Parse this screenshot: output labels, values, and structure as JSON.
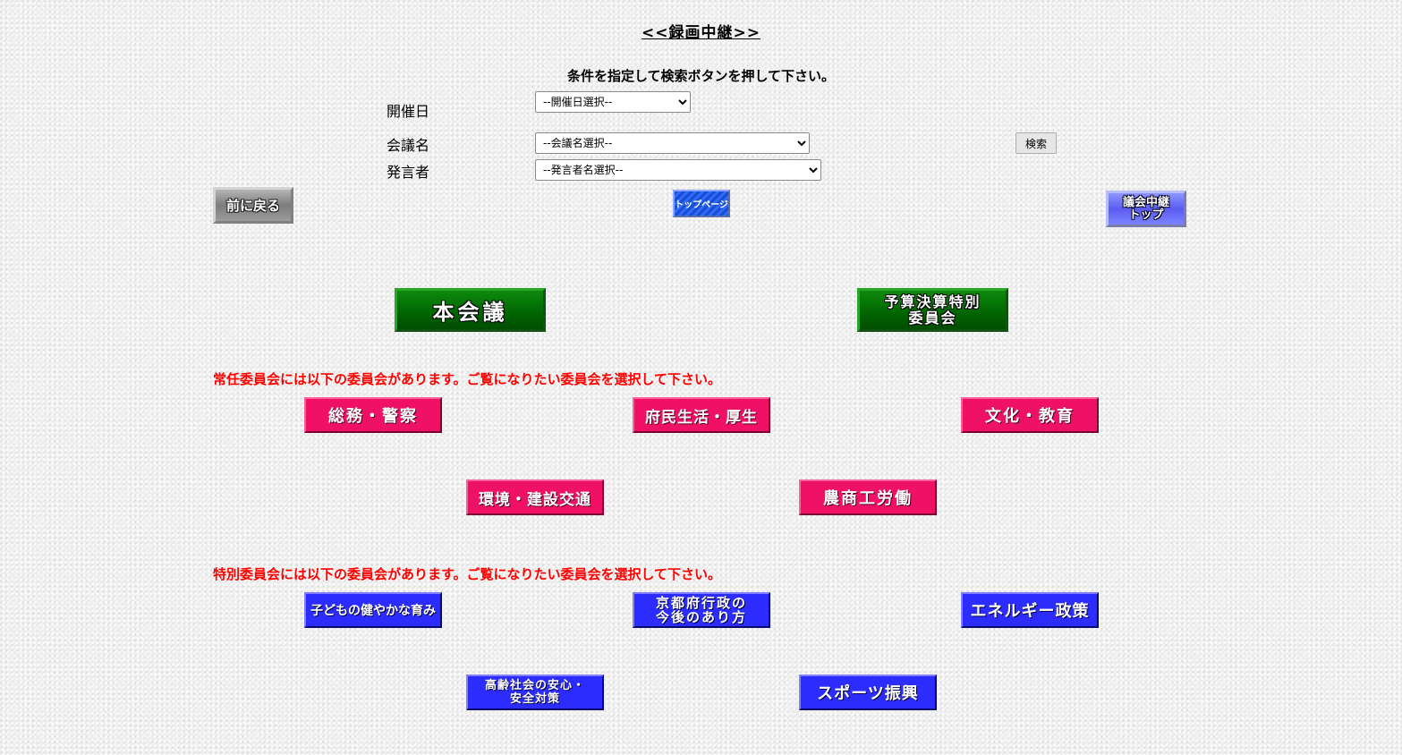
{
  "page": {
    "title": "<<録画中継>>",
    "instruction": "条件を指定して検索ボタンを押して下さい。"
  },
  "search": {
    "date_label": "開催日",
    "date_selected": "--開催日選択--",
    "meeting_label": "会議名",
    "meeting_selected": "--会議名選択--",
    "speaker_label": "発言者",
    "speaker_selected": "--発言者名選択--",
    "search_button": "検索"
  },
  "nav": {
    "back_label": "前に戻る",
    "top_page_label": "トップページ",
    "gikai_top_line1": "議会中継",
    "gikai_top_line2": "トップ"
  },
  "main": {
    "plenary_label": "本会議",
    "budget_line1": "予算決算特別",
    "budget_line2": "委員会"
  },
  "standing": {
    "note": "常任委員会には以下の委員会があります。ご覧になりたい委員会を選択して下さい。",
    "committees": [
      "総務・警察",
      "府民生活・厚生",
      "文化・教育",
      "環境・建設交通",
      "農商工労働"
    ]
  },
  "special": {
    "note": "特別委員会には以下の委員会があります。ご覧になりたい委員会を選択して下さい。",
    "committees": [
      {
        "line1": "子どもの健やかな育み",
        "line2": ""
      },
      {
        "line1": "京都府行政の",
        "line2": "今後のあり方"
      },
      {
        "line1": "エネルギー政策",
        "line2": ""
      },
      {
        "line1": "高齢社会の安心・",
        "line2": "安全対策"
      },
      {
        "line1": "スポーツ振興",
        "line2": ""
      }
    ]
  },
  "colors": {
    "standing_button": "#ee1166",
    "special_button": "#2c2cff",
    "main_button": "#006400",
    "note_text": "#ff0000"
  }
}
